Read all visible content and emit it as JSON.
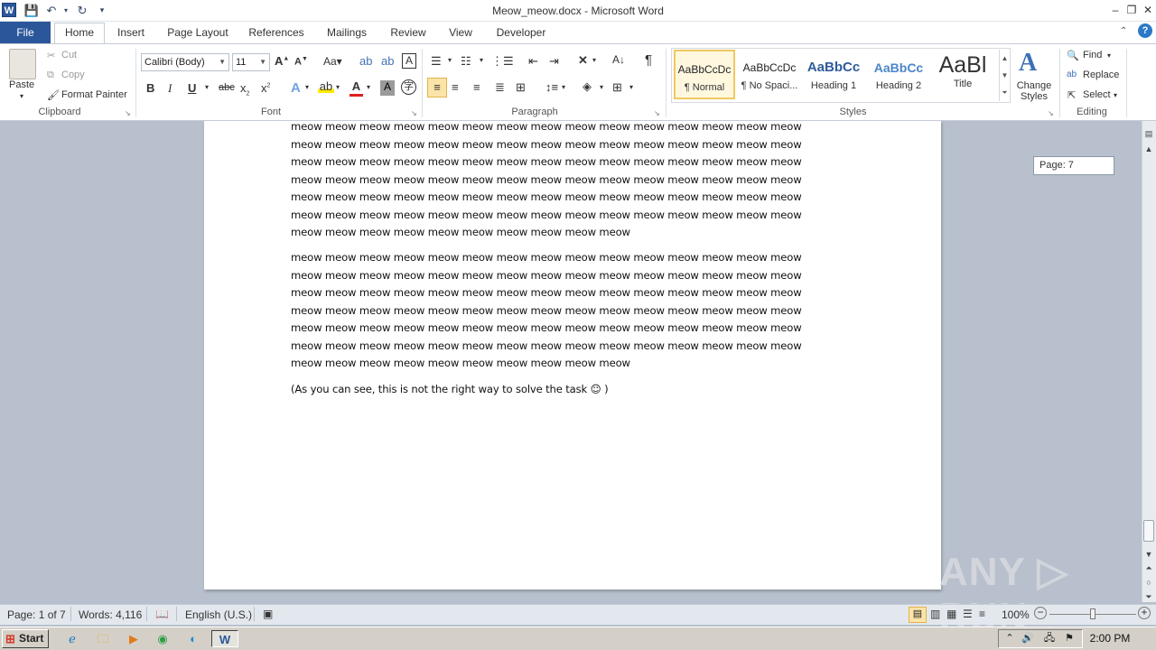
{
  "window": {
    "title": "Meow_meow.docx - Microsoft Word"
  },
  "tabs": {
    "file": "File",
    "home": "Home",
    "insert": "Insert",
    "page_layout": "Page Layout",
    "references": "References",
    "mailings": "Mailings",
    "review": "Review",
    "view": "View",
    "developer": "Developer"
  },
  "clipboard": {
    "paste": "Paste",
    "cut": "Cut",
    "copy": "Copy",
    "format_painter": "Format Painter",
    "label": "Clipboard"
  },
  "font": {
    "name": "Calibri (Body)",
    "size": "11",
    "label": "Font"
  },
  "paragraph": {
    "label": "Paragraph"
  },
  "styles": {
    "label": "Styles",
    "items": [
      {
        "sample": "AaBbCcDc",
        "name": "¶ Normal"
      },
      {
        "sample": "AaBbCcDc",
        "name": "¶ No Spaci..."
      },
      {
        "sample": "AaBbCc",
        "name": "Heading 1"
      },
      {
        "sample": "AaBbCc",
        "name": "Heading 2"
      },
      {
        "sample": "AaBl",
        "name": "Title"
      }
    ],
    "change_styles": "Change Styles"
  },
  "editing": {
    "find": "Find",
    "replace": "Replace",
    "select": "Select",
    "label": "Editing"
  },
  "document": {
    "line_full": "meow meow meow meow meow meow meow meow meow meow meow meow meow meow meow",
    "line_end": "meow meow meow meow meow meow meow meow meow meow",
    "closing_line": "(As you can see, this is not the right way to solve the task ☺ )"
  },
  "tooltip": {
    "page": "Page: 7"
  },
  "statusbar": {
    "page": "Page: 1 of 7",
    "words": "Words: 4,116",
    "language": "English (U.S.)",
    "zoom": "100%"
  },
  "taskbar": {
    "start": "Start",
    "clock": "2:00 PM"
  },
  "watermark": "ANY ▷ RUN"
}
